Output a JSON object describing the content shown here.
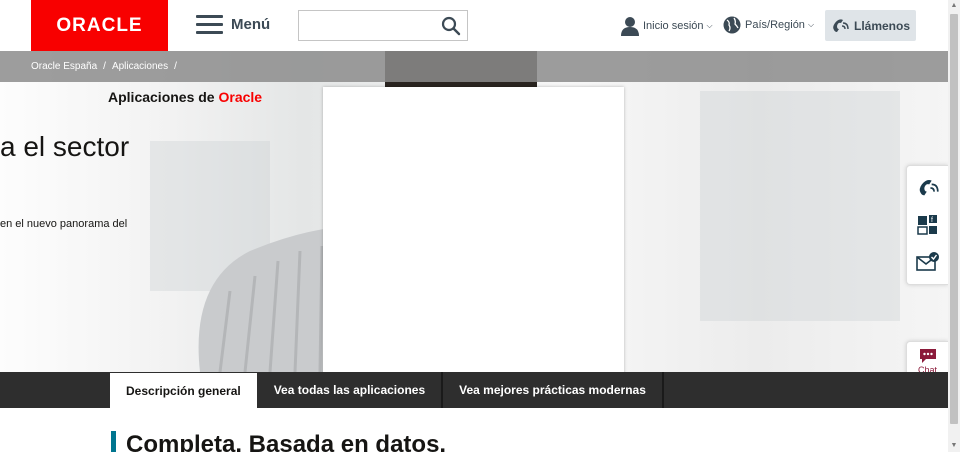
{
  "header": {
    "logo_text": "ORACLE",
    "menu_label": "Menú",
    "search_placeholder": "",
    "signin_label": "Inicio sesión",
    "country_label": "País/Región",
    "call_label": "Llámenos"
  },
  "breadcrumb": [
    {
      "label": "Oracle España"
    },
    {
      "label": "Aplicaciones"
    }
  ],
  "breadcrumb_separator": "/",
  "hero": {
    "section_title_prefix": "Aplicaciones de ",
    "section_title_brand": "Oracle",
    "headline": "a el sector",
    "subtext": "en el nuevo panorama del"
  },
  "side_rail": {
    "chat_label": "Chat"
  },
  "tabs": [
    {
      "label": "Descripción general",
      "active": true
    },
    {
      "label": "Vea todas las aplicaciones",
      "active": false
    },
    {
      "label": "Vea mejores prácticas modernas",
      "active": false
    }
  ],
  "content": {
    "title": "Completa. Basada en datos."
  },
  "colors": {
    "brand_red": "#f80000",
    "accent_teal": "#00758f",
    "chat_maroon": "#8b1a3a",
    "tabbar": "#2e2e2e"
  }
}
